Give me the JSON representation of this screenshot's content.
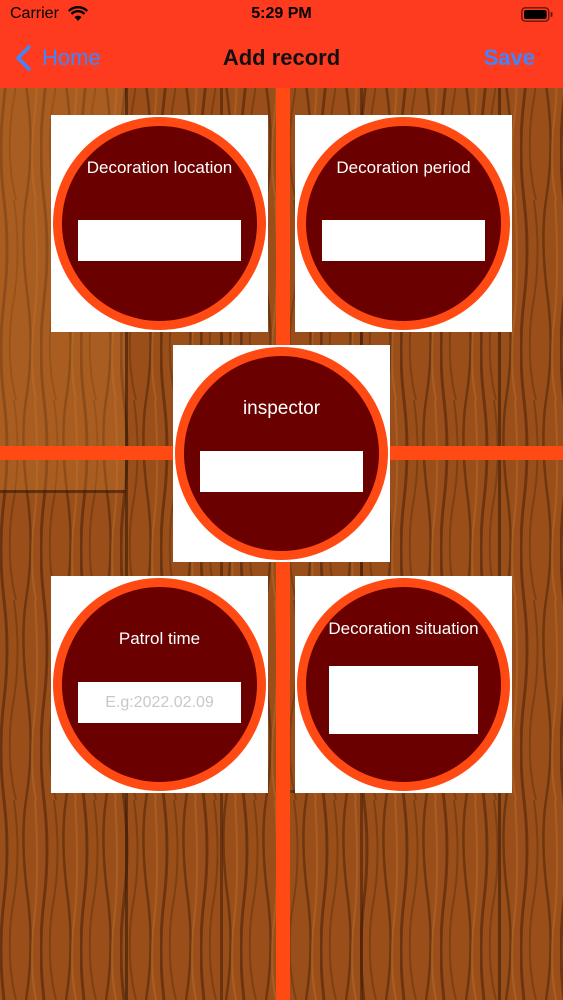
{
  "status_bar": {
    "carrier": "Carrier",
    "time": "5:29 PM"
  },
  "nav": {
    "back_label": "Home",
    "title": "Add record",
    "save_label": "Save"
  },
  "colors": {
    "header": "#ff3b1f",
    "accent_blue": "#3e86ff",
    "ring": "#ff4a14",
    "disc": "#6b0000"
  },
  "fields": {
    "location": {
      "label": "Decoration location",
      "value": "",
      "placeholder": ""
    },
    "period": {
      "label": "Decoration period",
      "value": "",
      "placeholder": ""
    },
    "inspector": {
      "label": "inspector",
      "value": "",
      "placeholder": ""
    },
    "patrol": {
      "label": "Patrol time",
      "value": "",
      "placeholder": "E.g:2022.02.09"
    },
    "situation": {
      "label": "Decoration situation",
      "value": "",
      "placeholder": ""
    }
  }
}
